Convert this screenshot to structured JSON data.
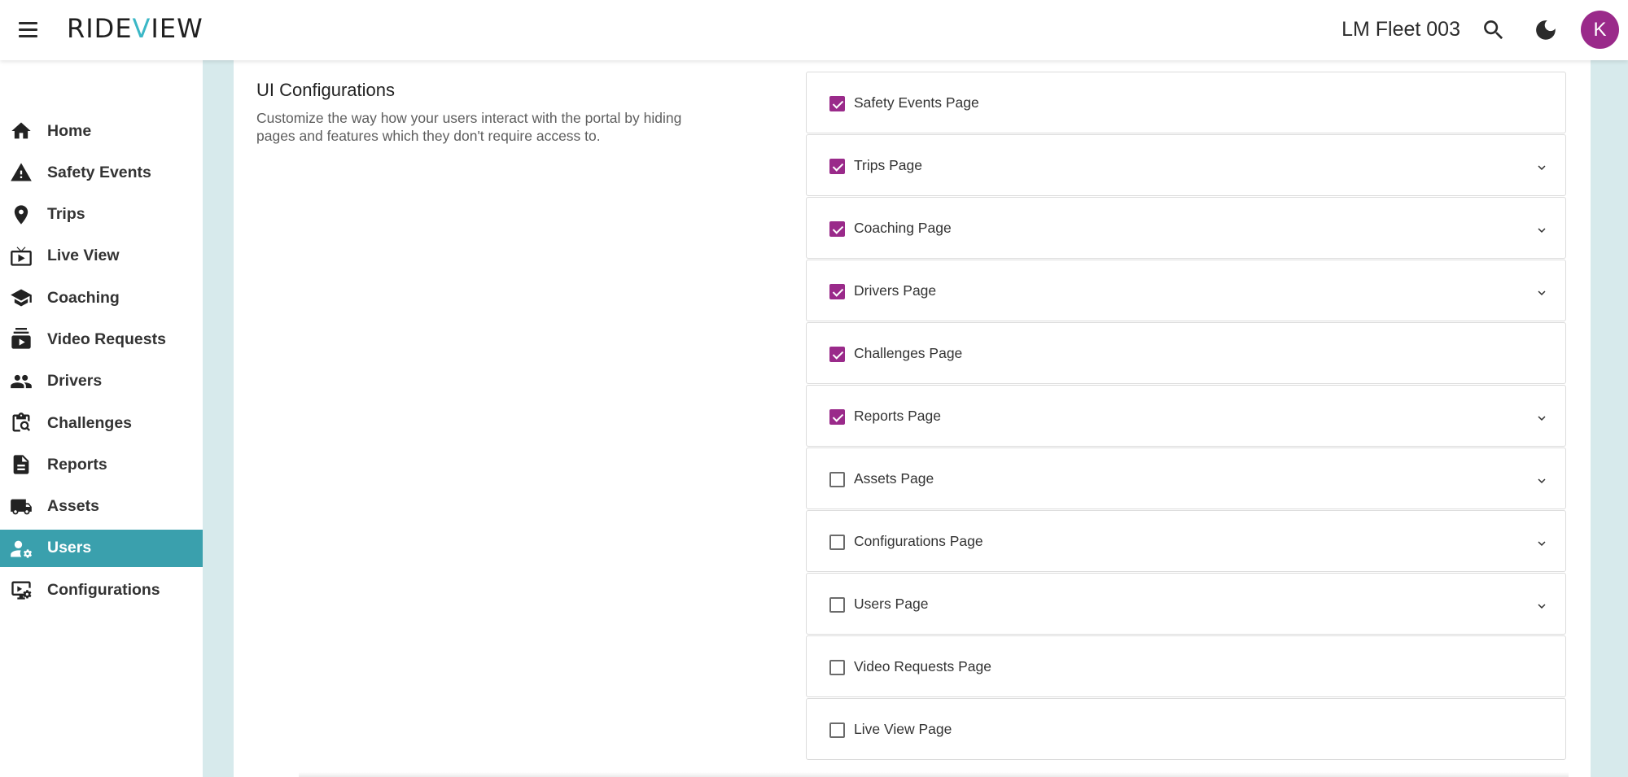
{
  "header": {
    "logo_text_left": "RIDE",
    "logo_text_v": "V",
    "logo_text_right": "IEW",
    "fleet_name": "LM Fleet 003",
    "avatar_initial": "K",
    "icons": [
      "menu-icon",
      "search-icon",
      "moon-icon"
    ]
  },
  "sidebar": {
    "items": [
      {
        "label": "Home",
        "icon": "home-icon",
        "active": false
      },
      {
        "label": "Safety Events",
        "icon": "warning-icon",
        "active": false
      },
      {
        "label": "Trips",
        "icon": "location-pin-icon",
        "active": false
      },
      {
        "label": "Live View",
        "icon": "live-tv-icon",
        "active": false
      },
      {
        "label": "Coaching",
        "icon": "school-icon",
        "active": false
      },
      {
        "label": "Video Requests",
        "icon": "video-library-icon",
        "active": false
      },
      {
        "label": "Drivers",
        "icon": "people-icon",
        "active": false
      },
      {
        "label": "Challenges",
        "icon": "clipboard-search-icon",
        "active": false
      },
      {
        "label": "Reports",
        "icon": "document-icon",
        "active": false
      },
      {
        "label": "Assets",
        "icon": "truck-icon",
        "active": false
      },
      {
        "label": "Users",
        "icon": "user-settings-icon",
        "active": true
      },
      {
        "label": "Configurations",
        "icon": "display-settings-icon",
        "active": false
      }
    ]
  },
  "ui_config": {
    "title": "UI Configurations",
    "description": "Customize the way how your users interact with the portal by hiding pages and features which they don't require access to.",
    "rows": [
      {
        "label": "Safety Events Page",
        "checked": true,
        "expandable": false
      },
      {
        "label": "Trips Page",
        "checked": true,
        "expandable": true
      },
      {
        "label": "Coaching Page",
        "checked": true,
        "expandable": true
      },
      {
        "label": "Drivers Page",
        "checked": true,
        "expandable": true
      },
      {
        "label": "Challenges Page",
        "checked": true,
        "expandable": false
      },
      {
        "label": "Reports Page",
        "checked": true,
        "expandable": true
      },
      {
        "label": "Assets Page",
        "checked": false,
        "expandable": true
      },
      {
        "label": "Configurations Page",
        "checked": false,
        "expandable": true
      },
      {
        "label": "Users Page",
        "checked": false,
        "expandable": true
      },
      {
        "label": "Video Requests Page",
        "checked": false,
        "expandable": false
      },
      {
        "label": "Live View Page",
        "checked": false,
        "expandable": false
      }
    ]
  },
  "colors": {
    "brand_accent": "#3bb7c6",
    "active_nav": "#3aa0ad",
    "checkbox_checked": "#9a2a8a",
    "avatar_bg": "#9a2a8a",
    "page_bg": "#d7eaec"
  }
}
